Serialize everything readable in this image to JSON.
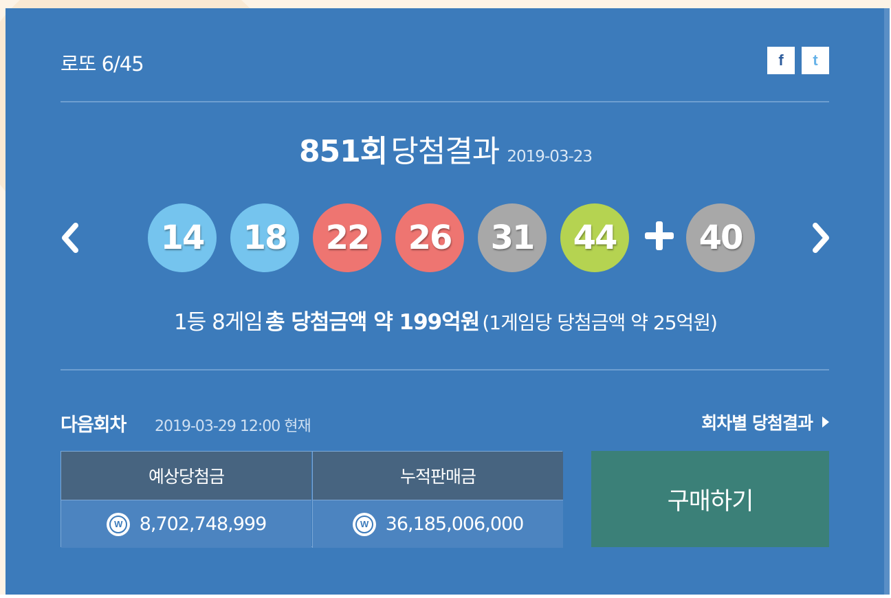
{
  "panel": {
    "title": "로또 6/45"
  },
  "share": {
    "facebook_icon": "f",
    "twitter_icon": "t"
  },
  "result": {
    "draw_no": "851회",
    "word": "당첨결과",
    "date": "2019-03-23"
  },
  "balls": [
    {
      "number": "14",
      "color": "#75c4ee"
    },
    {
      "number": "18",
      "color": "#75c4ee"
    },
    {
      "number": "22",
      "color": "#ee7571"
    },
    {
      "number": "26",
      "color": "#ee7571"
    },
    {
      "number": "31",
      "color": "#a8a8a8"
    },
    {
      "number": "44",
      "color": "#b5d351"
    }
  ],
  "bonus": {
    "number": "40",
    "color": "#a8a8a8"
  },
  "prize": {
    "part1": "1등 8게임",
    "part2": "총 당첨금액 약 199억원",
    "part3": "(1게임당 당첨금액 약 25억원)"
  },
  "next": {
    "label": "다음회차",
    "date": "2019-03-29 12:00 현재",
    "by_draw_link": "회차별 당첨결과"
  },
  "table": {
    "headers": [
      "예상당첨금",
      "누적판매금"
    ],
    "won_symbol": "W",
    "values": [
      "8,702,748,999",
      "36,185,006,000"
    ]
  },
  "buy_button": "구매하기"
}
